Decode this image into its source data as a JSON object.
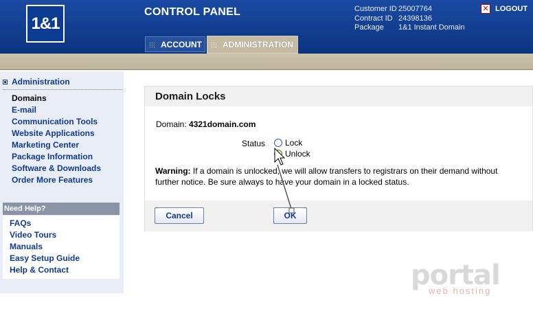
{
  "header": {
    "logo": "1&1",
    "title": "CONTROL PANEL",
    "customer": [
      {
        "label": "Customer ID",
        "value": "25007764"
      },
      {
        "label": "Contract ID",
        "value": "24398136"
      },
      {
        "label": "Package",
        "value": "1&1 Instant Domain"
      }
    ],
    "logout": "LOGOUT",
    "tabs": [
      {
        "label": "ACCOUNT",
        "active": false
      },
      {
        "label": "ADMINISTRATION",
        "active": true
      }
    ]
  },
  "sidebar": {
    "heading": "Administration",
    "items": [
      {
        "label": "Domains",
        "active": true
      },
      {
        "label": "E-mail"
      },
      {
        "label": "Communication Tools"
      },
      {
        "label": "Website Applications"
      },
      {
        "label": "Marketing Center"
      },
      {
        "label": "Package Information"
      },
      {
        "label": "Software & Downloads"
      },
      {
        "label": "Order More Features"
      }
    ],
    "help_heading": "Need Help?",
    "help_items": [
      {
        "label": "FAQs"
      },
      {
        "label": "Video Tours"
      },
      {
        "label": "Manuals"
      },
      {
        "label": "Easy Setup Guide"
      },
      {
        "label": "Help & Contact"
      }
    ]
  },
  "panel": {
    "title": "Domain Locks",
    "domain_label": "Domain:",
    "domain_value": "4321domain.com",
    "status_label": "Status",
    "options": [
      {
        "label": "Lock",
        "checked": false
      },
      {
        "label": "Unlock",
        "checked": true
      }
    ],
    "warning_label": "Warning:",
    "warning_text": "If a domain is unlocked, we will allow transfers to registrars on their demand without further notice. Be sure always to have your domain in a locked status.",
    "cancel_label": "Cancel",
    "ok_label": "OK"
  },
  "watermark": {
    "main": "portal",
    "sub": "web hosting"
  },
  "colors": {
    "header_blue": "#0f3a8e",
    "tab_bar_tan": "#c8bea6",
    "link_blue": "#0f3a8e"
  }
}
